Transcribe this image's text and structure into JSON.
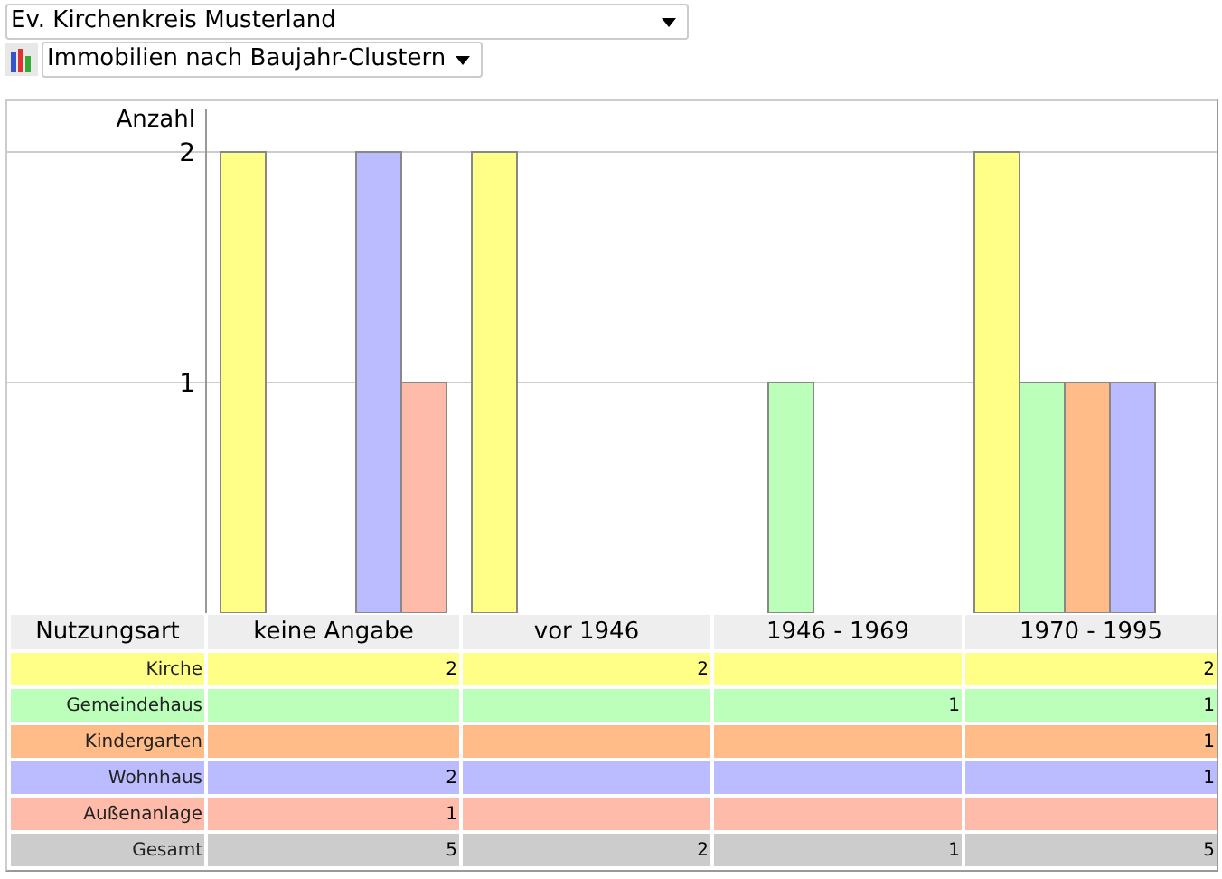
{
  "selectors": [
    {
      "kind": "plain",
      "value": "Ev. Kirchenkreis Musterland"
    },
    {
      "kind": "chart",
      "value": "Immobilien nach Baujahr-Clustern"
    }
  ],
  "chart_data": {
    "type": "bar",
    "ylabel": "Anzahl",
    "ylim": [
      0,
      2
    ],
    "yticks": [
      1,
      2
    ],
    "categories": [
      "keine Angabe",
      "vor 1946",
      "1946 - 1969",
      "1970 - 1995"
    ],
    "series": [
      {
        "name": "Kirche",
        "color": "#ffff88",
        "values": [
          2,
          2,
          null,
          2
        ]
      },
      {
        "name": "Gemeindehaus",
        "color": "#bbffbb",
        "values": [
          null,
          null,
          1,
          1
        ]
      },
      {
        "name": "Kindergarten",
        "color": "#ffbb88",
        "values": [
          null,
          null,
          null,
          1
        ]
      },
      {
        "name": "Wohnhaus",
        "color": "#bbbbff",
        "values": [
          2,
          null,
          null,
          1
        ]
      },
      {
        "name": "Außenanlage",
        "color": "#ffbbaa",
        "values": [
          1,
          null,
          null,
          null
        ]
      }
    ]
  },
  "table": {
    "first_column": "Nutzungsart",
    "rows": [
      {
        "cells": [
          "2",
          "2",
          null,
          "2"
        ]
      },
      {
        "cells": [
          null,
          null,
          "1",
          "1"
        ]
      },
      {
        "cells": [
          null,
          null,
          null,
          "1"
        ]
      },
      {
        "cells": [
          "2",
          null,
          null,
          "1"
        ]
      },
      {
        "cells": [
          "1",
          null,
          null,
          null
        ]
      }
    ],
    "total": {
      "label": "Gesamt",
      "values": [
        "5",
        "2",
        "1",
        "5"
      ]
    }
  }
}
